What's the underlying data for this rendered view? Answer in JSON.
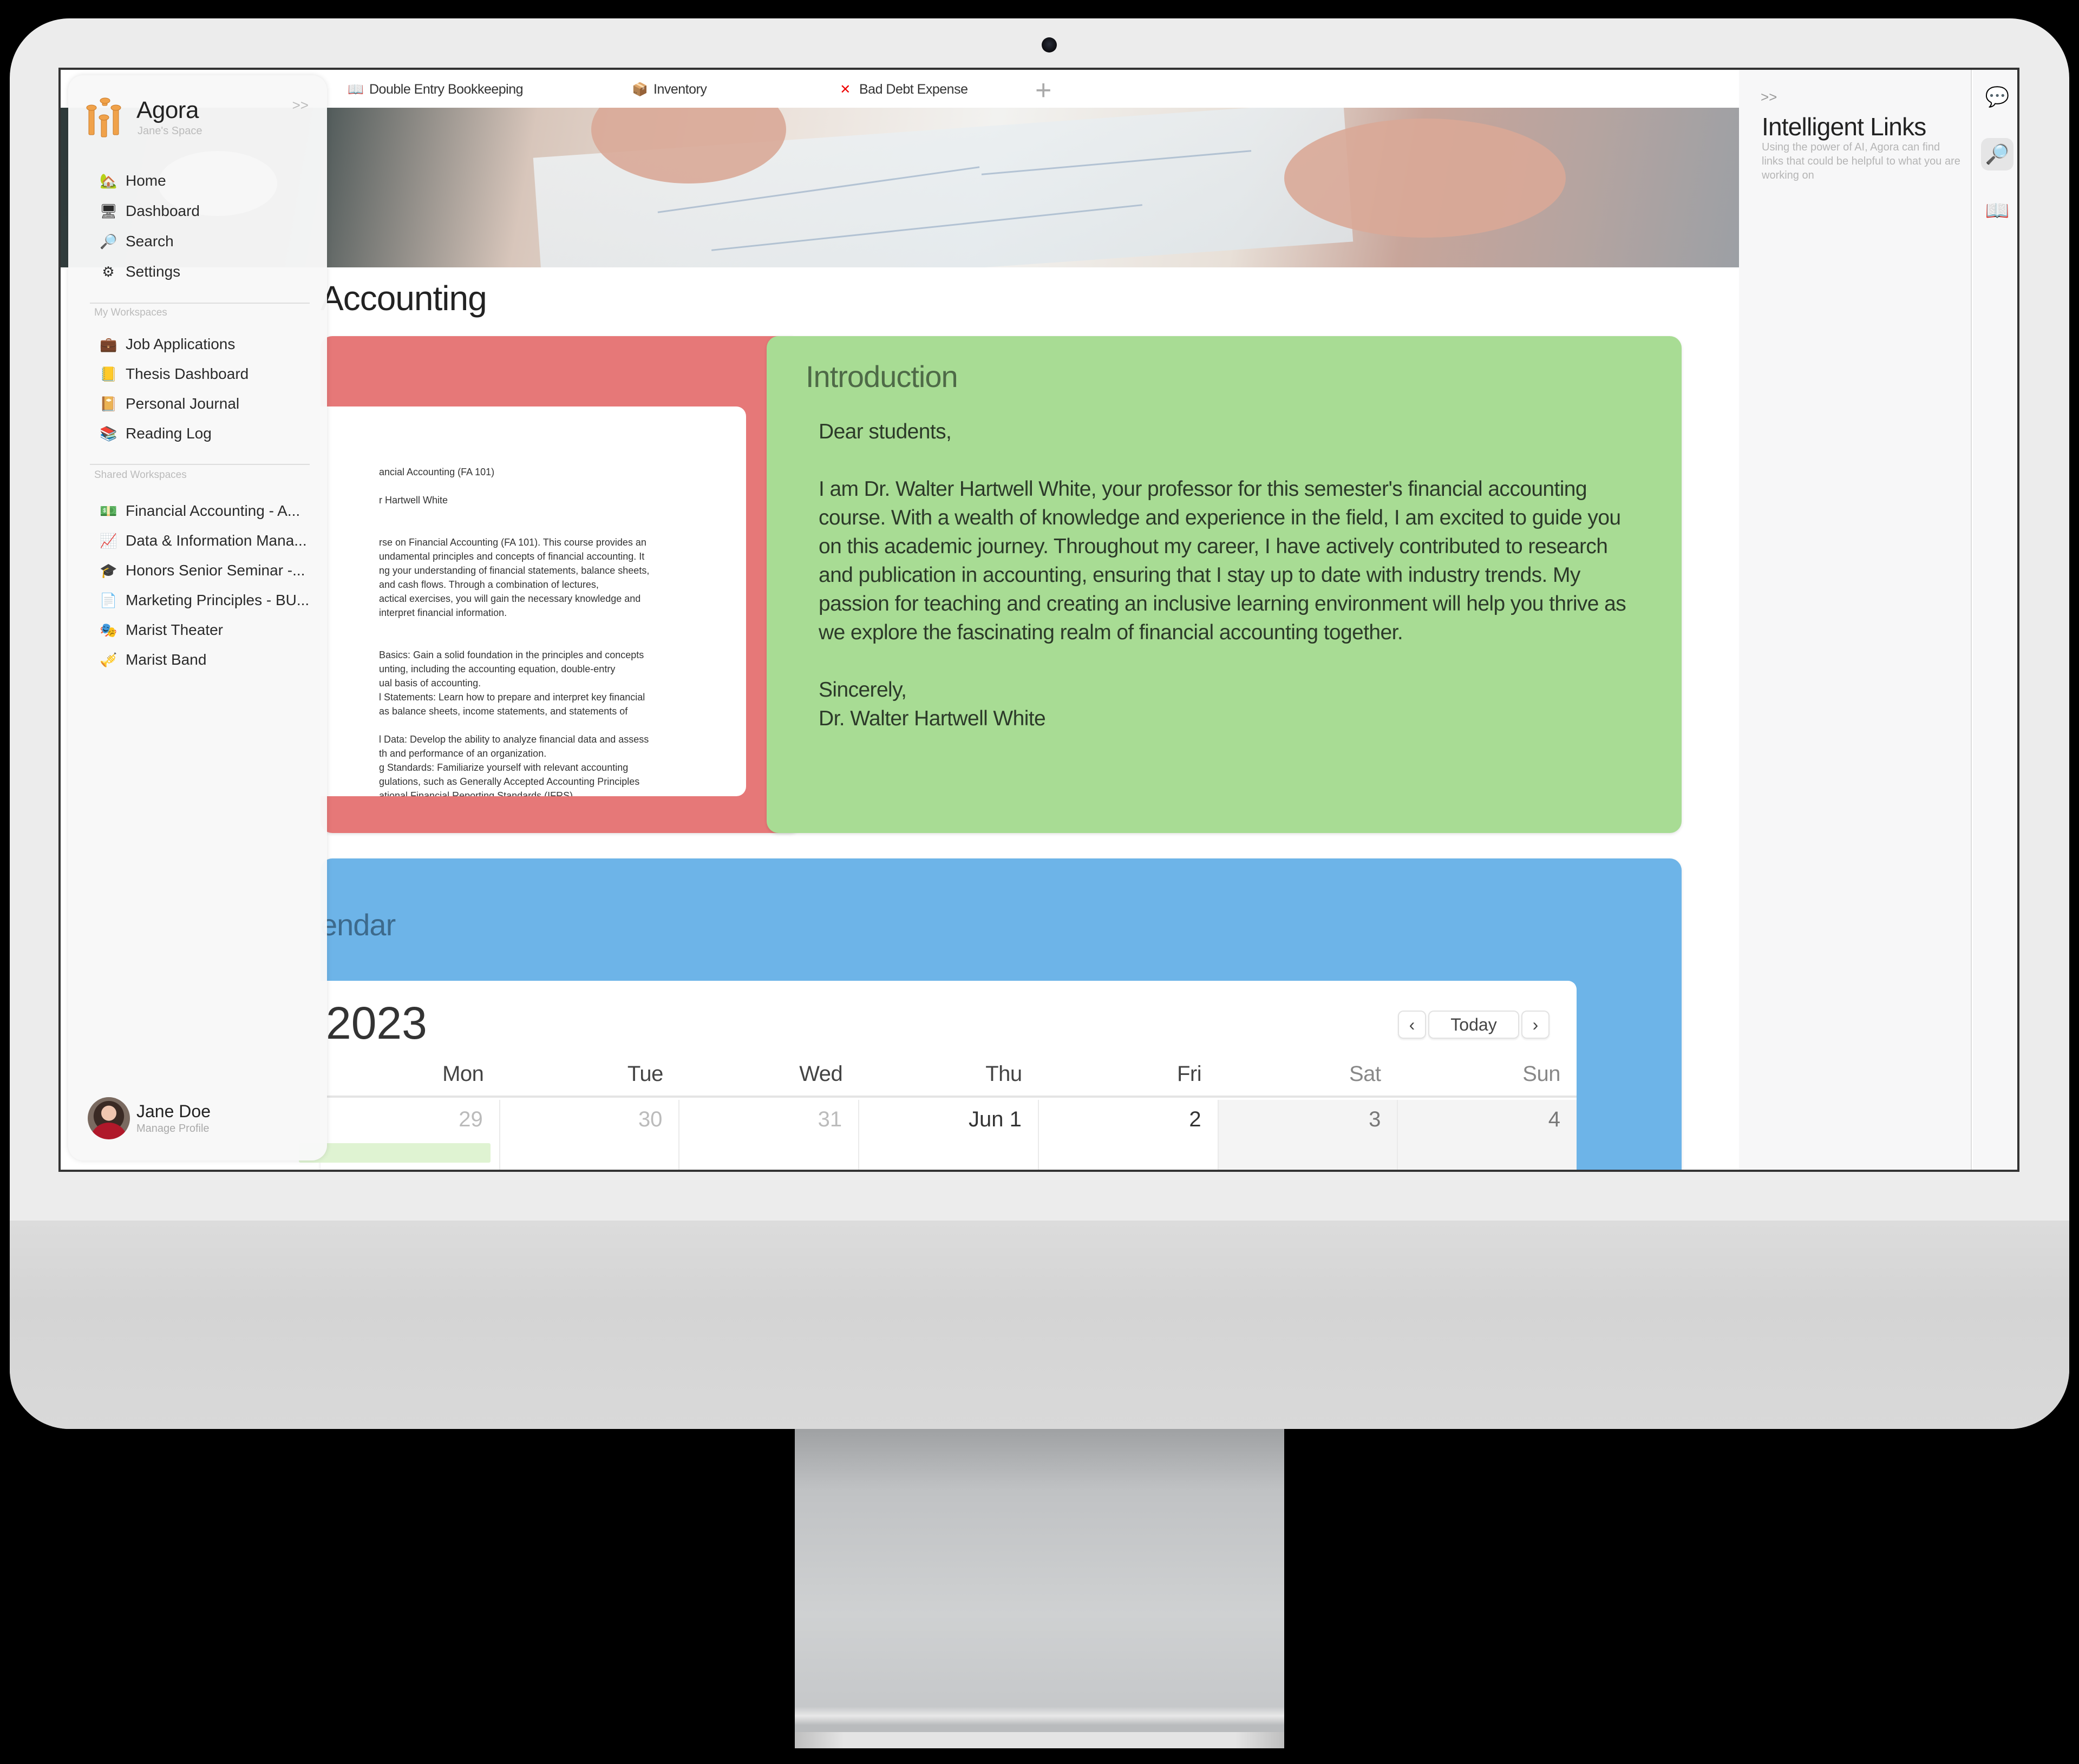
{
  "app": {
    "name": "Agora",
    "space": "Jane's Space",
    "collapse_label": ">>"
  },
  "sidebar": {
    "main_nav": [
      {
        "label": "Home",
        "icon": "🏡",
        "icon_name": "house-icon"
      },
      {
        "label": "Dashboard",
        "icon": "🖥",
        "icon_name": "desktop-icon"
      },
      {
        "label": "Search",
        "icon": "🔎",
        "icon_name": "magnifier-icon"
      },
      {
        "label": "Settings",
        "icon": "⚙",
        "icon_name": "gear-icon"
      }
    ],
    "my_workspaces_label": "My Workspaces",
    "my_workspaces": [
      {
        "label": "Job Applications",
        "icon": "💼",
        "icon_name": "briefcase-icon"
      },
      {
        "label": "Thesis Dashboard",
        "icon": "📒",
        "icon_name": "notebook-icon"
      },
      {
        "label": "Personal Journal",
        "icon": "📔",
        "icon_name": "journal-icon"
      },
      {
        "label": "Reading Log",
        "icon": "📚",
        "icon_name": "books-icon"
      }
    ],
    "shared_workspaces_label": "Shared Workspaces",
    "shared_workspaces": [
      {
        "label": "Financial Accounting - A...",
        "icon": "💵",
        "icon_name": "money-icon",
        "selected": true
      },
      {
        "label": "Data & Information Mana...",
        "icon": "📈",
        "icon_name": "chart-increasing-icon"
      },
      {
        "label": "Honors Senior Seminar -...",
        "icon": "🎓",
        "icon_name": "graduation-cap-icon"
      },
      {
        "label": "Marketing Principles - BU...",
        "icon": "📄",
        "icon_name": "document-icon"
      },
      {
        "label": "Marist Theater",
        "icon": "🎭",
        "icon_name": "theater-masks-icon"
      },
      {
        "label": "Marist Band",
        "icon": "🎺",
        "icon_name": "trumpet-icon"
      }
    ],
    "profile": {
      "name": "Jane Doe",
      "subtitle": "Manage Profile"
    }
  },
  "tabs": [
    {
      "label": "Double Entry Bookkeeping",
      "icon": "📖",
      "icon_name": "book-icon"
    },
    {
      "label": "Inventory",
      "icon": "📦",
      "icon_name": "package-icon"
    },
    {
      "label": "Bad Debt Expense",
      "icon": "❌",
      "icon_name": "cross-mark-icon"
    }
  ],
  "tab_add_label": "+",
  "page": {
    "title_visible": "Accounting",
    "syllabus_lines": [
      "ancial Accounting (FA 101)",
      "",
      "r Hartwell White",
      "",
      "",
      "rse on Financial Accounting (FA 101). This course provides an",
      "undamental principles and concepts of financial accounting. It",
      "ng your understanding of financial statements, balance sheets,",
      "and cash flows. Through a combination of lectures,",
      "actical exercises, you will gain the necessary knowledge and",
      " interpret financial information.",
      "",
      "",
      "Basics: Gain a solid foundation in the principles and concepts",
      "unting, including the accounting equation, double-entry",
      "ual basis of accounting.",
      "l Statements: Learn how to prepare and interpret key financial",
      " as balance sheets, income statements, and statements of",
      "",
      "l Data: Develop the ability to analyze financial data and assess",
      "th and performance of an organization.",
      "g Standards: Familiarize yourself with relevant accounting",
      "gulations, such as Generally Accepted Accounting Principles",
      "ational Financial Reporting Standards (IFRS)"
    ],
    "introduction": {
      "heading": "Introduction",
      "greeting": "Dear students,",
      "body": "I am Dr. Walter Hartwell White, your professor for this semester's financial accounting course. With a wealth of knowledge and experience in the field, I am excited to guide you on this academic journey. Throughout my career, I have actively contributed to research and publication in accounting, ensuring that I stay up to date with industry trends. My passion for teaching and creating an inclusive learning environment will help you thrive as we explore the fascinating realm of financial accounting together.",
      "closing": "Sincerely,",
      "signature": "Dr. Walter Hartwell White"
    },
    "calendar": {
      "section_heading_visible": "endar",
      "title_visible": "2023",
      "prev_label": "‹",
      "today_label": "Today",
      "next_label": "›",
      "weekdays": [
        "Mon",
        "Tue",
        "Wed",
        "Thu",
        "Fri",
        "Sat",
        "Sun"
      ],
      "days": [
        {
          "label": "29",
          "current_month": false,
          "weekend": false
        },
        {
          "label": "30",
          "current_month": false,
          "weekend": false
        },
        {
          "label": "31",
          "current_month": false,
          "weekend": false
        },
        {
          "label": "Jun 1",
          "current_month": true,
          "weekend": false
        },
        {
          "label": "2",
          "current_month": true,
          "weekend": false
        },
        {
          "label": "3",
          "current_month": true,
          "weekend": true
        },
        {
          "label": "4",
          "current_month": true,
          "weekend": true
        }
      ]
    }
  },
  "right_panel": {
    "collapse_label": ">>",
    "title": "Intelligent Links",
    "description": "Using the power of AI, Agora can find links that could be helpful to what you are working on"
  },
  "icon_column": [
    {
      "icon": "💬",
      "name": "speech-bubble-icon",
      "active": false
    },
    {
      "icon": "🔎",
      "name": "magnifier-icon",
      "active": true
    },
    {
      "icon": "📖",
      "name": "open-book-icon",
      "active": false
    }
  ],
  "colors": {
    "syllabus_card": "#e67878",
    "introduction_card": "#a8dc94",
    "calendar_card": "#6db4e8",
    "logo_orange": "#f0a24a"
  }
}
